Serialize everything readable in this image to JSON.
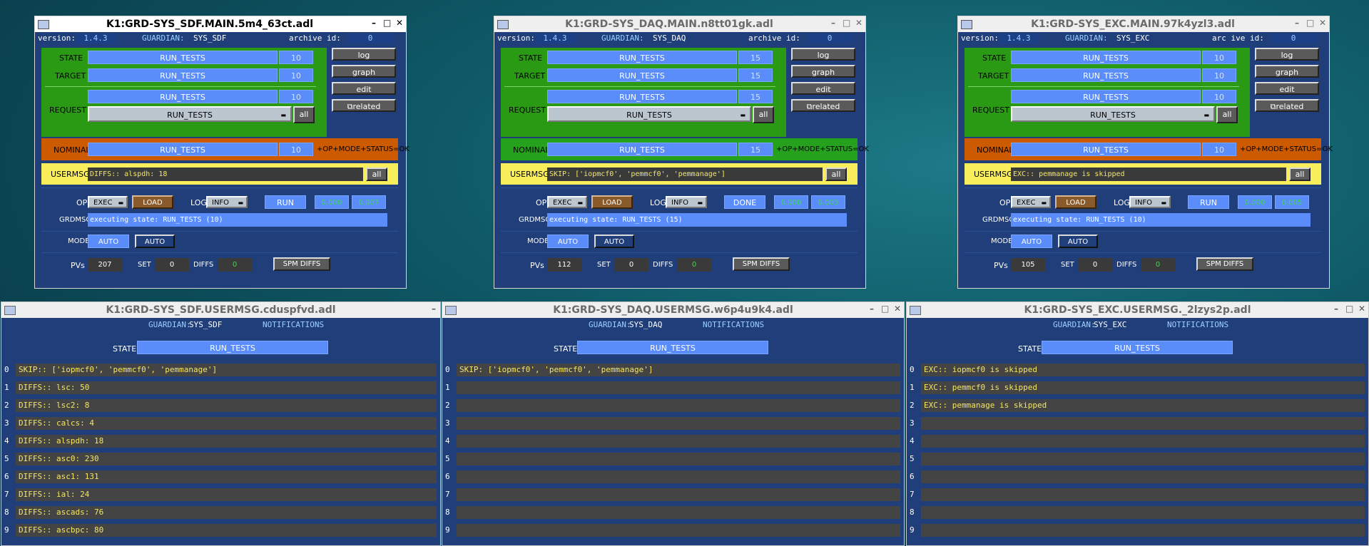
{
  "main_windows": [
    {
      "title": "K1:GRD-SYS_SDF.MAIN.5m4_63ct.adl",
      "active": true,
      "version_label": "version:",
      "version": "1.4.3",
      "guardian_label": "GUARDIAN:",
      "guardian": "SYS_SDF",
      "archive_label": "archive id:",
      "archive_id": "0",
      "state_label": "STATE",
      "state": "RUN_TESTS",
      "state_num": "10",
      "target_label": "TARGET",
      "target": "RUN_TESTS",
      "target_num": "10",
      "request_label": "REQUEST",
      "request": "RUN_TESTS",
      "request_num": "10",
      "request_select": "RUN_TESTS",
      "all_label": "all",
      "btn_log": "log",
      "btn_graph": "graph",
      "btn_edit": "edit",
      "btn_related": "related",
      "nominal_label": "NOMINAL",
      "nominal": "RUN_TESTS",
      "nominal_num": "10",
      "nominal_status": "+OP+MODE+STATUS=OK",
      "nominal_color": "#cc5a00",
      "usermsg_label": "USERMSG",
      "usermsg": "DIFFS:: alspdh: 18",
      "op_label": "OP",
      "op": "EXEC",
      "load_label": "LOAD",
      "log_label": "LOG",
      "log_level": "INFO",
      "run_status": "RUN",
      "val1": "0.000",
      "val2": "0.007",
      "grdmsg_label": "GRDMSG",
      "grdmsg": "executing state: RUN_TESTS (10)",
      "mode_label": "MODE",
      "mode": "AUTO",
      "mode_btn": "AUTO",
      "pvs_label": "PVs",
      "pvs": "207",
      "set_label": "SET",
      "set": "0",
      "diffs_label": "DIFFS",
      "diffs": "0",
      "spm_label": "SPM DIFFS"
    },
    {
      "title": "K1:GRD-SYS_DAQ.MAIN.n8tt01gk.adl",
      "active": false,
      "version_label": "version:",
      "version": "1.4.3",
      "guardian_label": "GUARDIAN:",
      "guardian": "SYS_DAQ",
      "archive_label": "archive id:",
      "archive_id": "0",
      "state_label": "STATE",
      "state": "RUN_TESTS",
      "state_num": "15",
      "target_label": "TARGET",
      "target": "RUN_TESTS",
      "target_num": "15",
      "request_label": "REQUEST",
      "request": "RUN_TESTS",
      "request_num": "15",
      "request_select": "RUN_TESTS",
      "all_label": "all",
      "btn_log": "log",
      "btn_graph": "graph",
      "btn_edit": "edit",
      "btn_related": "related",
      "nominal_label": "NOMINAL",
      "nominal": "RUN_TESTS",
      "nominal_num": "15",
      "nominal_status": "+OP+MODE+STATUS=OK",
      "nominal_color": "#25a11d",
      "usermsg_label": "USERMSG",
      "usermsg": "SKIP: ['iopmcf0', 'pemmcf0', 'pemmanage']",
      "op_label": "OP",
      "op": "EXEC",
      "load_label": "LOAD",
      "log_label": "LOG",
      "log_level": "INFO",
      "run_status": "DONE",
      "val1": "0.000",
      "val2": "0.003",
      "grdmsg_label": "GRDMSG",
      "grdmsg": "executing state: RUN_TESTS (15)",
      "mode_label": "MODE",
      "mode": "AUTO",
      "mode_btn": "AUTO",
      "pvs_label": "PVs",
      "pvs": "112",
      "set_label": "SET",
      "set": "0",
      "diffs_label": "DIFFS",
      "diffs": "0",
      "spm_label": "SPM DIFFS"
    },
    {
      "title": "K1:GRD-SYS_EXC.MAIN.97k4yzl3.adl",
      "active": false,
      "version_label": "version:",
      "version": "1.4.3",
      "guardian_label": "GUARDIAN:",
      "guardian": "SYS_EXC",
      "archive_label": "arc ive id:",
      "archive_id": "0",
      "state_label": "STATE",
      "state": "RUN_TESTS",
      "state_num": "10",
      "target_label": "TARGET",
      "target": "RUN_TESTS",
      "target_num": "10",
      "request_label": "REQUEST",
      "request": "RUN_TESTS",
      "request_num": "10",
      "request_select": "RUN_TESTS",
      "all_label": "all",
      "btn_log": "log",
      "btn_graph": "graph",
      "btn_edit": "edit",
      "btn_related": "related",
      "nominal_label": "NOMINAL",
      "nominal": "RUN_TESTS",
      "nominal_num": "10",
      "nominal_status": "+OP+MODE+STATUS=OK",
      "nominal_color": "#cc5a00",
      "usermsg_label": "USERMSG",
      "usermsg": "EXC:: pemmanage is skipped",
      "op_label": "OP",
      "op": "EXEC",
      "load_label": "LOAD",
      "log_label": "LOG",
      "log_level": "INFO",
      "run_status": "RUN",
      "val1": "0.000",
      "val2": "0.005",
      "grdmsg_label": "GRDMSG",
      "grdmsg": "executing state: RUN_TESTS (10)",
      "mode_label": "MODE",
      "mode": "AUTO",
      "mode_btn": "AUTO",
      "pvs_label": "PVs",
      "pvs": "105",
      "set_label": "SET",
      "set": "0",
      "diffs_label": "DIFFS",
      "diffs": "0",
      "spm_label": "SPM DIFFS"
    }
  ],
  "usermsg_windows": [
    {
      "title": "K1:GRD-SYS_SDF.USERMSG.cduspfvd.adl",
      "guardian_label": "GUARDIAN:",
      "guardian": "SYS_SDF",
      "notifications_label": "NOTIFICATIONS",
      "state_label": "STATE",
      "state": "RUN_TESTS",
      "messages": [
        "SKIP:: ['iopmcf0', 'pemmcf0', 'pemmanage']",
        "DIFFS:: lsc: 50",
        "DIFFS:: lsc2: 8",
        "DIFFS:: calcs: 4",
        "DIFFS:: alspdh: 18",
        "DIFFS:: asc0: 230",
        "DIFFS:: asc1: 131",
        "DIFFS:: ial: 24",
        "DIFFS:: ascads: 76",
        "DIFFS:: ascbpc: 80"
      ]
    },
    {
      "title": "K1:GRD-SYS_DAQ.USERMSG.w6p4u9k4.adl",
      "guardian_label": "GUARDIAN:",
      "guardian": "SYS_DAQ",
      "notifications_label": "NOTIFICATIONS",
      "state_label": "STATE",
      "state": "RUN_TESTS",
      "messages": [
        "SKIP: ['iopmcf0', 'pemmcf0', 'pemmanage']",
        "",
        "",
        "",
        "",
        "",
        "",
        "",
        "",
        ""
      ]
    },
    {
      "title": "K1:GRD-SYS_EXC.USERMSG._2lzys2p.adl",
      "guardian_label": "GUARDIAN:",
      "guardian": "SYS_EXC",
      "notifications_label": "NOTIFICATIONS",
      "state_label": "STATE",
      "state": "RUN_TESTS",
      "messages": [
        "EXC:: iopmcf0 is skipped",
        "EXC:: pemmcf0 is skipped",
        "EXC:: pemmanage is skipped",
        "",
        "",
        "",
        "",
        "",
        "",
        ""
      ]
    }
  ],
  "row_indices": [
    "0",
    "1",
    "2",
    "3",
    "4",
    "5",
    "6",
    "7",
    "8",
    "9"
  ]
}
